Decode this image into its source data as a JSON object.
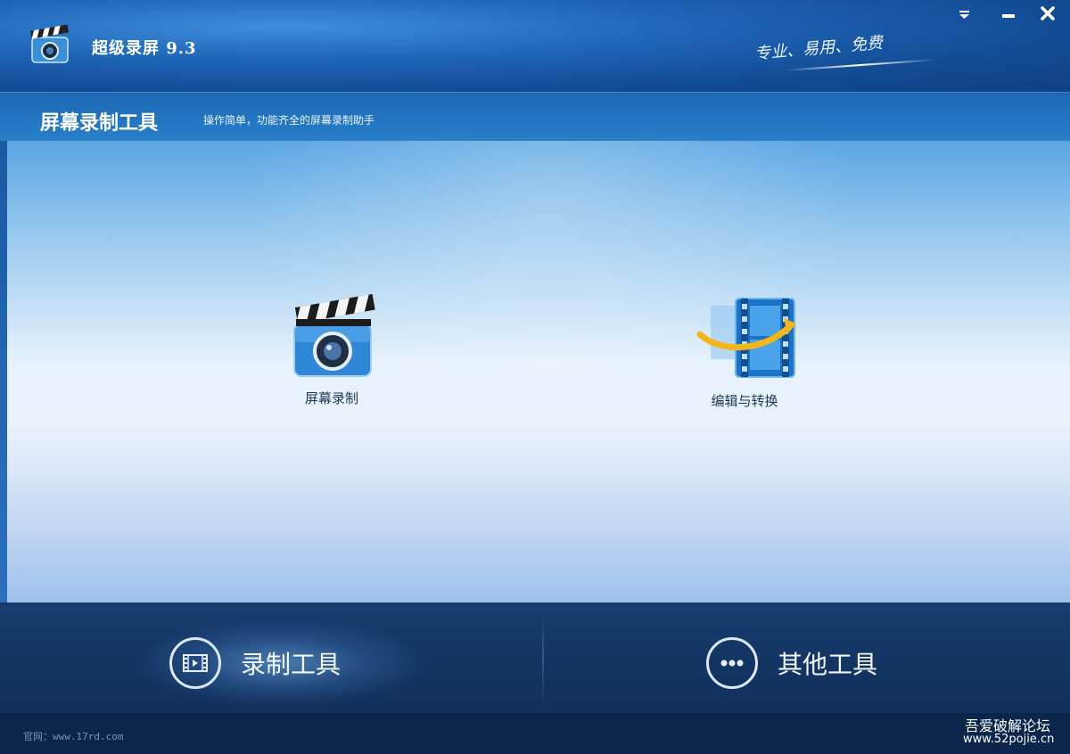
{
  "window": {
    "title": "超级录屏 9.3",
    "slogan": "专业、易用、免费"
  },
  "subheader": {
    "title": "屏幕录制工具",
    "description": "操作简单，功能齐全的屏幕录制助手"
  },
  "tools": [
    {
      "label": "屏幕录制",
      "icon": "clapperboard-camera-icon"
    },
    {
      "label": "编辑与转换",
      "icon": "film-convert-icon"
    }
  ],
  "tabs": [
    {
      "label": "录制工具",
      "icon": "film-frame-icon",
      "active": true
    },
    {
      "label": "其他工具",
      "icon": "more-dots-icon",
      "active": false
    }
  ],
  "footer": {
    "site": "官网：www.17rd.com",
    "watermark_line1": "吾爱破解论坛",
    "watermark_line2": "www.52pojie.cn"
  },
  "colors": {
    "titlebar": "#134c95",
    "bottom_bar": "#112f5b",
    "accent_gold": "#f2b51c"
  }
}
